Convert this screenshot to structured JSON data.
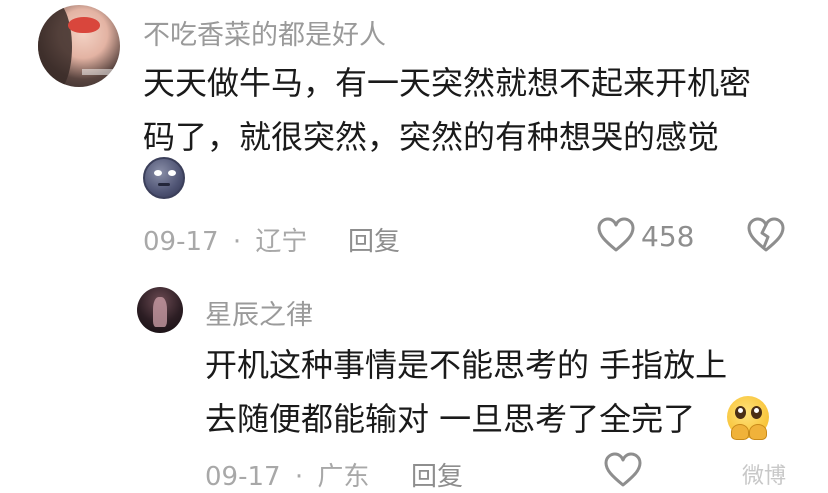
{
  "comment": {
    "username": "不吃香菜的都是好人",
    "text_line1": "天天做牛马，有一天突然就想不起来开机密",
    "text_line2": "码了，就很突然，突然的有种想哭的感觉",
    "emoji": "new-moon-face-emoji",
    "date": "09-17",
    "dot": "·",
    "location": "辽宁",
    "reply_label": "回复",
    "like_count": "458",
    "like_icon": "heart-outline-icon",
    "dislike_icon": "broken-heart-icon"
  },
  "reply": {
    "username": "星辰之律",
    "text_line1": "开机这种事情是不能思考的 手指放上",
    "text_line2": "去随便都能输对 一旦思考了全完了",
    "emoji": "crying-face-emoji",
    "date": "09-17",
    "dot": "·",
    "location": "广东",
    "reply_label": "回复",
    "like_icon": "heart-outline-icon"
  },
  "watermark": "微博"
}
